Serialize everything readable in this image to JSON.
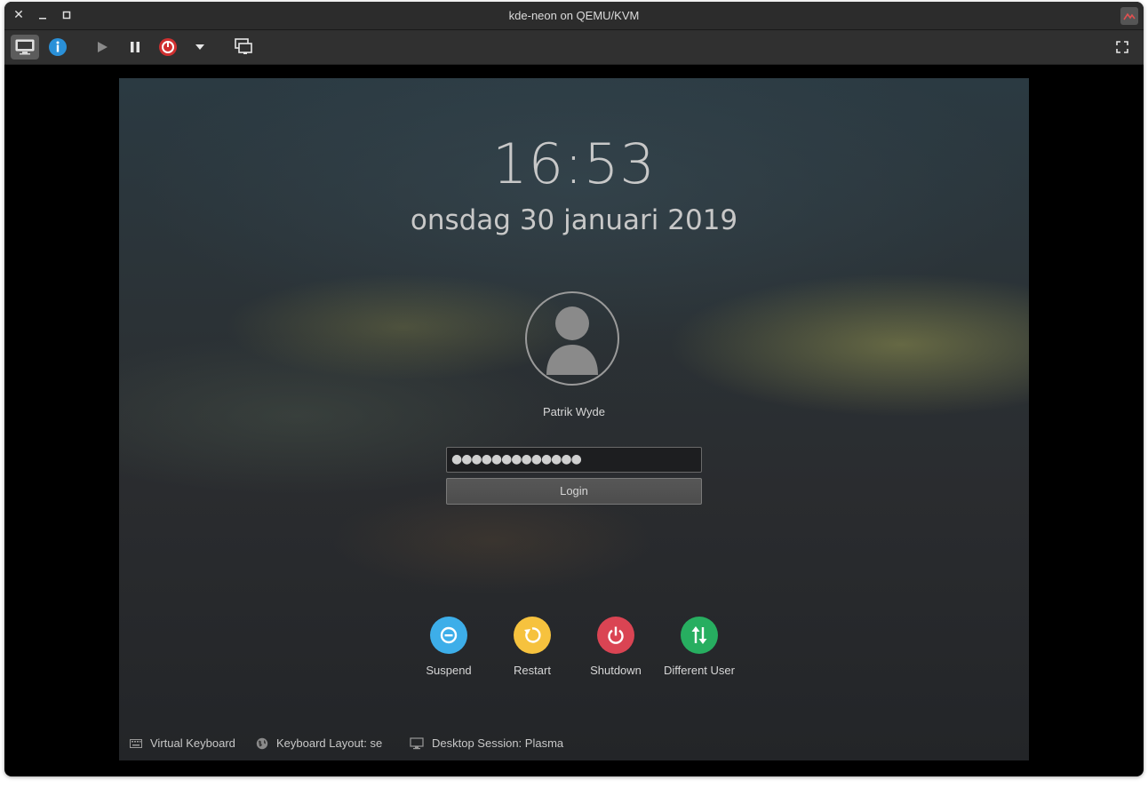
{
  "window": {
    "title": "kde-neon on QEMU/KVM",
    "controls": [
      "close-icon",
      "minimize-icon",
      "maximize-icon"
    ]
  },
  "toolbar": {
    "buttons": [
      "show-console-icon",
      "details-icon",
      "run-icon",
      "pause-icon",
      "shutdown-icon",
      "dropdown-arrow-icon",
      "snapshots-icon",
      "fullscreen-icon"
    ],
    "active": "show-console-icon"
  },
  "lockscreen": {
    "time": "16:53",
    "date": "onsdag 30 januari 2019",
    "user": "Patrik Wyde",
    "password_mask": "●●●●●●●●●●●●●",
    "login_label": "Login",
    "actions": [
      {
        "label": "Suspend",
        "color": "#3daee9",
        "icon": "suspend-icon"
      },
      {
        "label": "Restart",
        "color": "#f6c23e",
        "icon": "restart-icon"
      },
      {
        "label": "Shutdown",
        "color": "#da4453",
        "icon": "power-icon"
      },
      {
        "label": "Different User",
        "color": "#27ae60",
        "icon": "switch-user-icon"
      }
    ],
    "footer": {
      "virtual_keyboard": "Virtual Keyboard",
      "keyboard_layout": "Keyboard Layout: se",
      "desktop_session": "Desktop Session: Plasma"
    }
  }
}
